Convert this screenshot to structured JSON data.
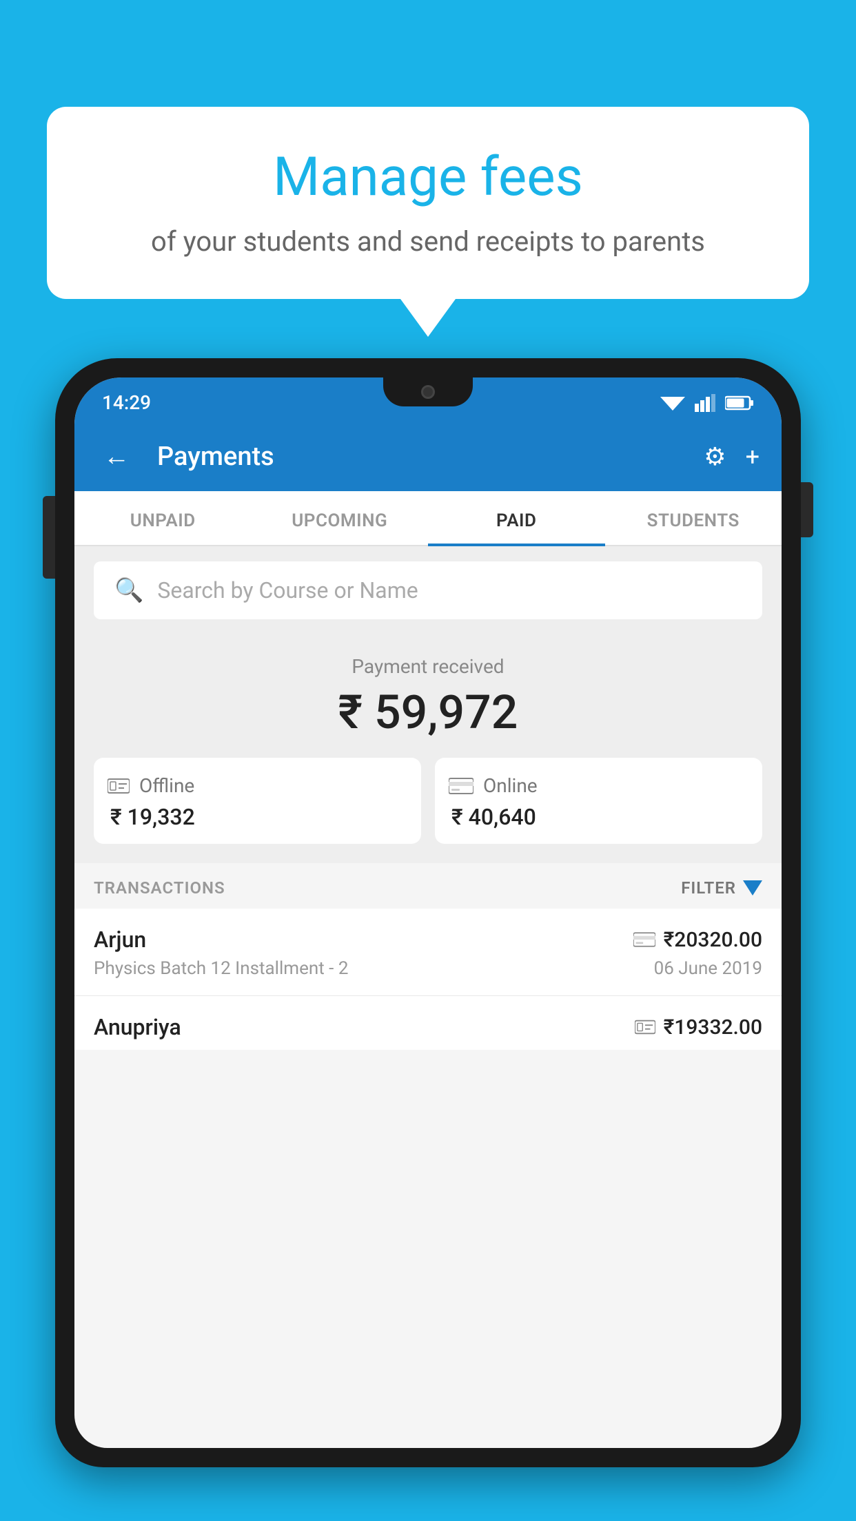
{
  "background_color": "#1ab3e8",
  "bubble": {
    "title": "Manage fees",
    "subtitle": "of your students and send receipts to parents"
  },
  "status_bar": {
    "time": "14:29",
    "wifi": "▼",
    "signal": "▲",
    "battery": "▮"
  },
  "app_bar": {
    "title": "Payments",
    "back_label": "←",
    "gear_label": "⚙",
    "plus_label": "+"
  },
  "tabs": [
    {
      "id": "unpaid",
      "label": "UNPAID",
      "active": false
    },
    {
      "id": "upcoming",
      "label": "UPCOMING",
      "active": false
    },
    {
      "id": "paid",
      "label": "PAID",
      "active": true
    },
    {
      "id": "students",
      "label": "STUDENTS",
      "active": false
    }
  ],
  "search": {
    "placeholder": "Search by Course or Name"
  },
  "payment_summary": {
    "label": "Payment received",
    "amount": "₹ 59,972",
    "offline_label": "Offline",
    "offline_amount": "₹ 19,332",
    "online_label": "Online",
    "online_amount": "₹ 40,640"
  },
  "transactions": {
    "header": "TRANSACTIONS",
    "filter": "FILTER",
    "items": [
      {
        "name": "Arjun",
        "amount": "₹20320.00",
        "course": "Physics Batch 12 Installment - 2",
        "date": "06 June 2019",
        "icon": "card"
      },
      {
        "name": "Anupriya",
        "amount": "₹19332.00",
        "course": "",
        "date": "",
        "icon": "cash"
      }
    ]
  }
}
